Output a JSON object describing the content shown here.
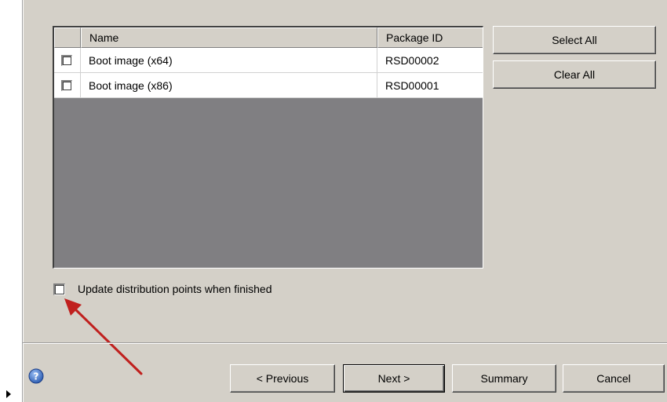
{
  "table": {
    "headers": {
      "name": "Name",
      "package_id": "Package ID"
    },
    "rows": [
      {
        "name": "Boot image (x64)",
        "package_id": "RSD00002"
      },
      {
        "name": "Boot image (x86)",
        "package_id": "RSD00001"
      }
    ]
  },
  "side_buttons": {
    "select_all": "Select All",
    "clear_all": "Clear All"
  },
  "update_option": {
    "label": "Update distribution points when finished"
  },
  "nav_buttons": {
    "previous": "< Previous",
    "next": "Next >",
    "summary": "Summary",
    "cancel": "Cancel"
  },
  "icons": {
    "help": "help-icon",
    "expand": "expand-arrow-icon",
    "annotation": "red-arrow-annotation"
  },
  "colors": {
    "annotation_arrow": "#c0201e",
    "help_icon": "#2f5fb3",
    "list_background": "#807f82"
  }
}
